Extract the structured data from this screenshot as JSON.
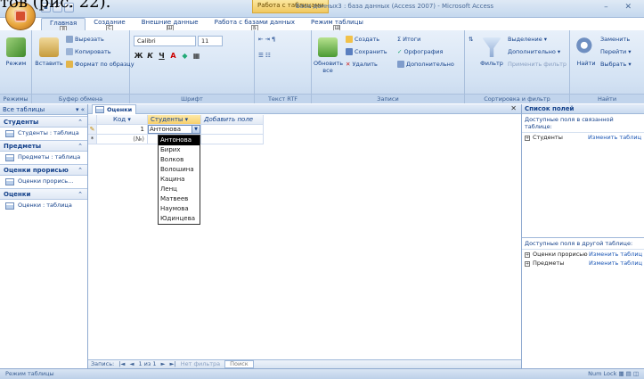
{
  "caption": "тов (рис. 22).",
  "window": {
    "context_tab": "Работа с таблицами",
    "title": "База данных3 : база данных (Access 2007) - Microsoft Access"
  },
  "ribbon_tabs": [
    {
      "label": "Главная",
      "key": "Я"
    },
    {
      "label": "Создание",
      "key": "С"
    },
    {
      "label": "Внешние данные",
      "key": "Ш"
    },
    {
      "label": "Работа с базами данных",
      "key": "Б"
    },
    {
      "label": "Режим таблицы",
      "key": "Ш"
    }
  ],
  "ribbon": {
    "groups": {
      "views": "Режимы",
      "clipboard": "Буфер обмена",
      "font": "Шрифт",
      "rtf": "Текст RTF",
      "records": "Записи",
      "sort": "Сортировка и фильтр",
      "find": "Найти"
    },
    "mode_btn": "Режим",
    "paste_btn": "Вставить",
    "cut": "Вырезать",
    "copy": "Копировать",
    "format_painter": "Формат по образцу",
    "font_name": "Calibri",
    "font_size": "11",
    "refresh": "Обновить все",
    "new_rec": "Создать",
    "save_rec": "Сохранить",
    "delete_rec": "Удалить",
    "totals": "Итоги",
    "spelling": "Орфография",
    "more": "Дополнительно",
    "filter_btn": "Фильтр",
    "selection": "Выделение",
    "advanced": "Дополнительно",
    "apply_filter": "Применить фильтр",
    "find_btn": "Найти",
    "replace": "Заменить",
    "goto": "Перейти",
    "select": "Выбрать"
  },
  "navpane": {
    "header": "Все таблицы",
    "groups": [
      {
        "title": "Студенты",
        "items": [
          "Студенты : таблица"
        ]
      },
      {
        "title": "Предметы",
        "items": [
          "Предметы : таблица"
        ]
      },
      {
        "title": "Оценки прорисью",
        "items": [
          "Оценки прорись..."
        ]
      },
      {
        "title": "Оценки",
        "items": [
          "Оценки : таблица"
        ]
      }
    ]
  },
  "document": {
    "tab": "Оценки",
    "columns": {
      "kod": "Код",
      "students": "Студенты",
      "add": "Добавить поле"
    },
    "rows": [
      {
        "sel": "✎",
        "kod": "1",
        "student": "Антонова"
      },
      {
        "sel": "*",
        "kod": "(№)",
        "student": ""
      }
    ],
    "dropdown_items": [
      "Антонова",
      "Бирих",
      "Волков",
      "Волошина",
      "Кацина",
      "Ленц",
      "Матвеев",
      "Наумова",
      "Юдинцева"
    ],
    "dropdown_highlight": "Антонова",
    "record_nav": {
      "label": "Запись:",
      "pos": "1 из 1",
      "filter": "Нет фильтра",
      "search": "Поиск"
    }
  },
  "fieldpane": {
    "title": "Список полей",
    "linked_header": "Доступные поля в связанной таблице:",
    "linked": [
      {
        "name": "Студенты",
        "action": "Изменить таблиц"
      }
    ],
    "other_header": "Доступные поля в другой таблице:",
    "other": [
      {
        "name": "Оценки прорисью",
        "action": "Изменить таблиц"
      },
      {
        "name": "Предметы",
        "action": "Изменить таблиц"
      }
    ]
  },
  "statusbar": {
    "left": "Режим таблицы",
    "right": "Num Lock"
  }
}
